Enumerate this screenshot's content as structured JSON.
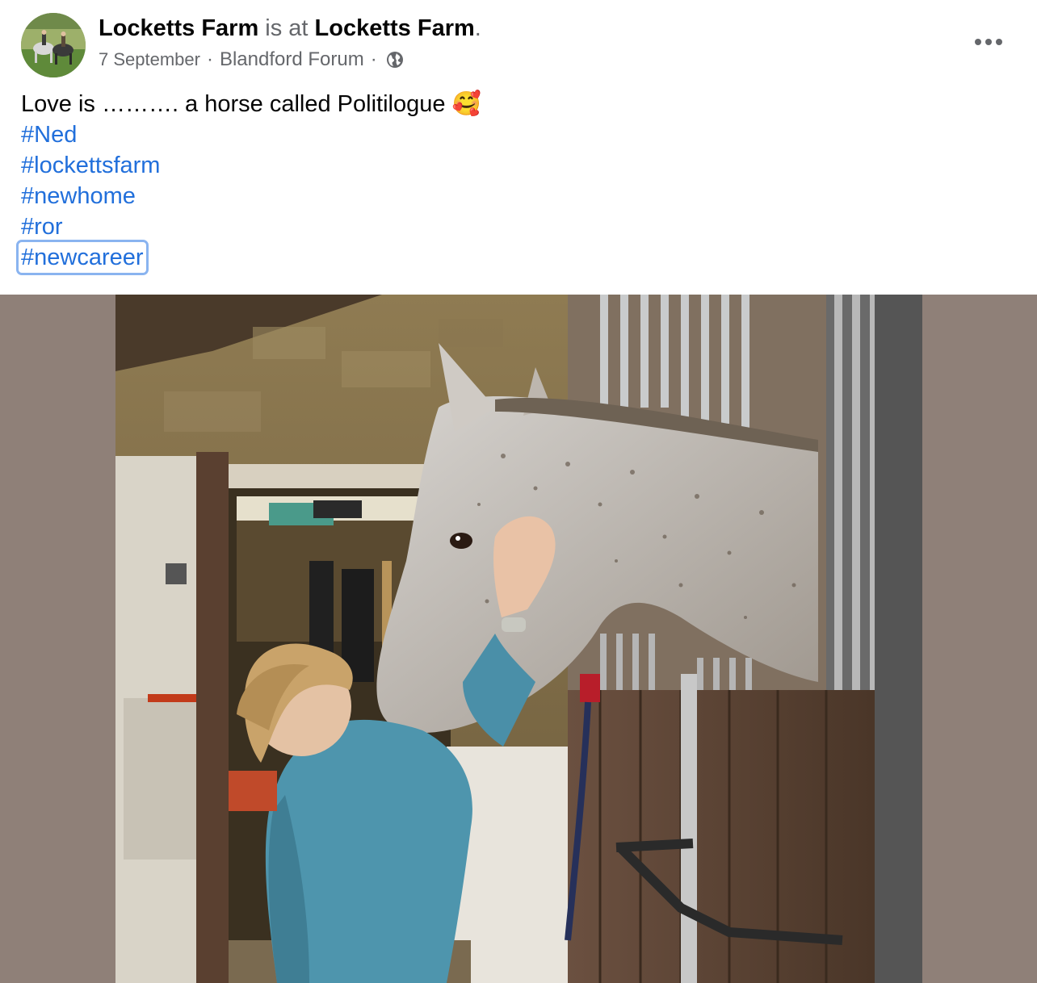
{
  "post": {
    "author": "Locketts Farm",
    "is_at_text": "is at",
    "location": "Locketts Farm",
    "period": ".",
    "date": "7 September",
    "place": "Blandford Forum",
    "separator": "·",
    "privacy_icon": "globe-icon",
    "more_icon": "more-options-icon",
    "text": "Love is ………. a horse called Politilogue 🥰",
    "hashtags": [
      "#Ned",
      "#lockettsfarm",
      "#newhome",
      "#ror",
      "#newcareer"
    ]
  },
  "colors": {
    "link": "#216fdb",
    "secondary_text": "#65676b",
    "photo_backdrop": "#8f8078",
    "focus_outline": "#8ab4f0"
  }
}
